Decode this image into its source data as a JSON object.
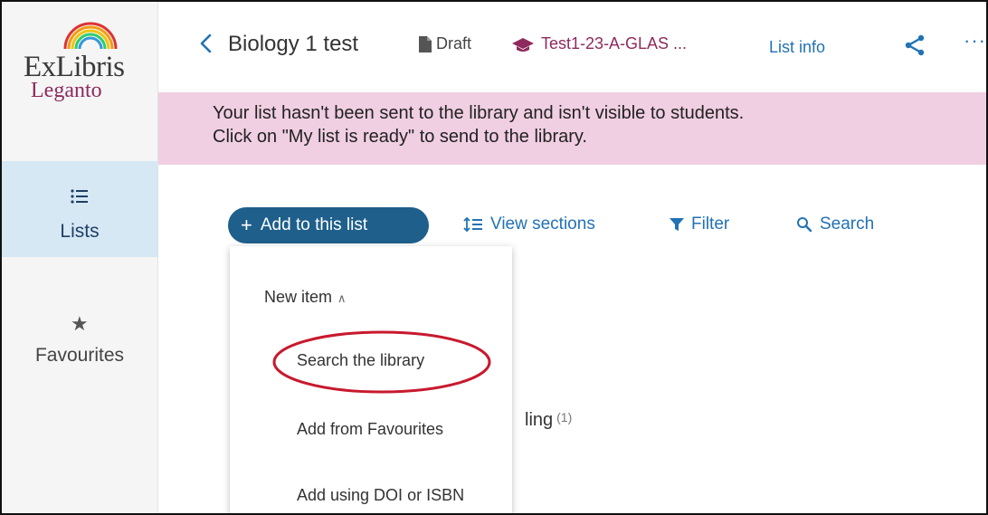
{
  "brand": {
    "name": "ExLibris",
    "product": "Leganto"
  },
  "sidebar": {
    "items": [
      {
        "label": "Lists",
        "icon": "list-icon",
        "active": true
      },
      {
        "label": "Favourites",
        "icon": "star-icon",
        "active": false
      }
    ]
  },
  "header": {
    "title": "Biology 1 test",
    "status": "Draft",
    "course": "Test1-23-A-GLAS ...",
    "list_info": "List info"
  },
  "banner": {
    "line1": "Your list hasn't been sent to the library and isn't visible to students.",
    "line2": "Click on \"My list is ready\" to send to the library."
  },
  "toolbar": {
    "add_label": "Add to this list",
    "view_sections": "View sections",
    "filter": "Filter",
    "search": "Search"
  },
  "menu": {
    "header": "New item",
    "items": [
      "Search the library",
      "Add from Favourites",
      "Add using DOI or ISBN"
    ],
    "highlighted_item": "Search the library",
    "highlight_color": "#c8192e"
  },
  "behind": {
    "section_fragment": "ling",
    "count": "(1)"
  },
  "colors": {
    "accent": "#1f5f8c",
    "link": "#2272b4",
    "course": "#8e2a5d",
    "banner": "#f0cfe2",
    "active_nav": "#d6e8f4"
  }
}
